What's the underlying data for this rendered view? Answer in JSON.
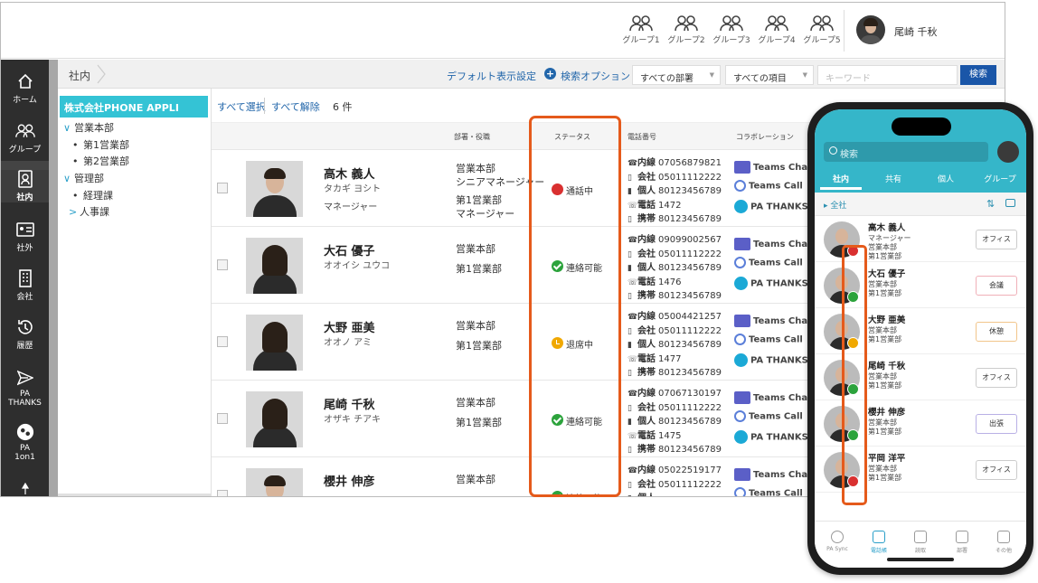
{
  "topbar": {
    "groups": [
      "グループ1",
      "グループ2",
      "グループ3",
      "グループ4",
      "グループ5"
    ],
    "user_name": "尾崎 千秋"
  },
  "sidebar": {
    "items": [
      {
        "label": "ホーム",
        "icon": "home-icon"
      },
      {
        "label": "グループ",
        "icon": "group-icon"
      },
      {
        "label": "社内",
        "icon": "company-directory-icon"
      },
      {
        "label": "社外",
        "icon": "external-contacts-icon"
      },
      {
        "label": "会社",
        "icon": "building-icon"
      },
      {
        "label": "履歴",
        "icon": "history-icon"
      },
      {
        "label": "PA THANKS",
        "icon": "paper-plane-icon"
      },
      {
        "label": "PA 1on1",
        "icon": "one-on-one-icon"
      }
    ],
    "active": "社内"
  },
  "breadcrumb": {
    "current": "社内"
  },
  "search": {
    "default_view": "デフォルト表示設定",
    "options": "検索オプション",
    "dept_select": "すべての部署",
    "field_select": "すべての項目",
    "keyword_placeholder": "キーワード",
    "button": "検索"
  },
  "tree": {
    "root": "株式会社PHONE APPLI",
    "nodes": [
      {
        "label": "営業本部",
        "marker": "∨"
      },
      {
        "label": "第1営業部",
        "marker": "•"
      },
      {
        "label": "第2営業部",
        "marker": "•"
      },
      {
        "label": "管理部",
        "marker": "∨"
      },
      {
        "label": "経理課",
        "marker": "•"
      },
      {
        "label": "人事課",
        "marker": ">"
      }
    ]
  },
  "list_tools": {
    "select_all": "すべて選択",
    "deselect_all": "すべて解除",
    "count": "6 件"
  },
  "columns": {
    "dept": "部署・役職",
    "status": "ステータス",
    "phone": "電話番号",
    "collab": "コラボレーション"
  },
  "collab_labels": {
    "chat": "Teams Chat",
    "call": "Teams Call",
    "thanks": "PA THANKS"
  },
  "phone_labels": {
    "ext": "内線",
    "company": "会社",
    "personal": "個人",
    "tel": "電話",
    "mobile": "携帯"
  },
  "people": [
    {
      "name": "高木 義人",
      "kana": "タカギ ヨシト",
      "title": "マネージャー",
      "dept": [
        "営業本部",
        "シニアマネージャー",
        "第1営業部",
        "マネージャー"
      ],
      "status": "通話中",
      "status_color": "#d93030",
      "ext": "07056879821",
      "company": "05011112222",
      "personal": "80123456789",
      "tel": "1472",
      "mobile": "80123456789"
    },
    {
      "name": "大石 優子",
      "kana": "オオイシ ユウコ",
      "title": "",
      "dept": [
        "営業本部",
        "第1営業部"
      ],
      "status": "連絡可能",
      "status_color": "#2ca33c",
      "ext": "09099002567",
      "company": "05011112222",
      "personal": "80123456789",
      "tel": "1476",
      "mobile": "80123456789"
    },
    {
      "name": "大野 亜美",
      "kana": "オオノ アミ",
      "title": "",
      "dept": [
        "営業本部",
        "第1営業部"
      ],
      "status": "退席中",
      "status_color": "#f0a800",
      "ext": "05004421257",
      "company": "05011112222",
      "personal": "80123456789",
      "tel": "1477",
      "mobile": "80123456789"
    },
    {
      "name": "尾崎 千秋",
      "kana": "オザキ チアキ",
      "title": "",
      "dept": [
        "営業本部",
        "第1営業部"
      ],
      "status": "連絡可能",
      "status_color": "#2ca33c",
      "ext": "07067130197",
      "company": "05011112222",
      "personal": "80123456789",
      "tel": "1475",
      "mobile": "80123456789"
    },
    {
      "name": "櫻井 伸彦",
      "kana": "",
      "title": "",
      "dept": [
        "営業本部"
      ],
      "status": "連絡可能",
      "status_color": "#2ca33c",
      "ext": "05022519177",
      "company": "05011112222",
      "personal": "",
      "tel": "",
      "mobile": ""
    }
  ],
  "mobile": {
    "search_placeholder": "検索",
    "tabs": [
      "社内",
      "共有",
      "個人",
      "グループ"
    ],
    "sub_label": "全社",
    "contacts": [
      {
        "name": "高木 義人",
        "l1": "マネージャー",
        "l2": "営業本部",
        "l3": "第1営業部",
        "badge": "オフィス",
        "status_color": "#d93030"
      },
      {
        "name": "大石 優子",
        "l1": "営業本部",
        "l2": "第1営業部",
        "l3": "",
        "badge": "会議",
        "status_color": "#2ca33c"
      },
      {
        "name": "大野 亜美",
        "l1": "営業本部",
        "l2": "第1営業部",
        "l3": "",
        "badge": "休憩",
        "status_color": "#f0a800"
      },
      {
        "name": "尾崎 千秋",
        "l1": "営業本部",
        "l2": "第1営業部",
        "l3": "",
        "badge": "オフィス",
        "status_color": "#2ca33c"
      },
      {
        "name": "櫻井 伸彦",
        "l1": "営業本部",
        "l2": "第1営業部",
        "l3": "",
        "badge": "出張",
        "status_color": "#2ca33c"
      },
      {
        "name": "平岡 洋平",
        "l1": "営業本部",
        "l2": "第1営業部",
        "l3": "",
        "badge": "オフィス",
        "status_color": "#d93030"
      }
    ],
    "nav": [
      "PA Sync",
      "電話帳",
      "読取",
      "部署",
      "その他"
    ]
  }
}
